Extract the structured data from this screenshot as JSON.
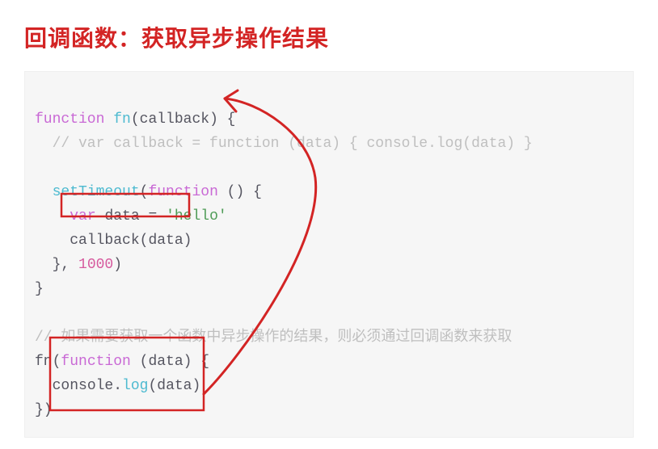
{
  "title": "回调函数：获取异步操作结果",
  "code": {
    "l1_kw": "function",
    "l1_fn": "fn",
    "l1_open": "(",
    "l1_param": "callback",
    "l1_close": ") {",
    "l2_full": "  // var callback = function (data) { console.log(data) }",
    "l3_blank": "",
    "l4_indent": "  ",
    "l4_fn": "setTimeout",
    "l4_open": "(",
    "l4_kw": "function",
    "l4_close": " () {",
    "l5_indent": "    ",
    "l5_kw": "var",
    "l5_sp": " ",
    "l5_id": "data",
    "l5_eq": " = ",
    "l5_str": "'hello'",
    "l6_indent": "    ",
    "l6_call": "callback",
    "l6_open": "(",
    "l6_arg": "data",
    "l6_close": ")",
    "l7_indent": "  }, ",
    "l7_num": "1000",
    "l7_close": ")",
    "l8": "}",
    "l9_blank": "",
    "l10_full": "// 如果需要获取一个函数中异步操作的结果，则必须通过回调函数来获取",
    "l11_fn": "fn",
    "l11_open": "(",
    "l11_kw": "function",
    "l11_rest": " (data) {",
    "l12_indent": "  ",
    "l12_obj": "console",
    "l12_dot": ".",
    "l12_log": "log",
    "l12_open": "(",
    "l12_arg": "data",
    "l12_close": ")",
    "l13": "})"
  },
  "annotations": {
    "box1_desc": "highlight callback(data) call",
    "box2_desc": "highlight callback-function argument to fn",
    "arrow_desc": "arrow from callback body up to callback parameter"
  },
  "colors": {
    "title": "#d32424",
    "keyword": "#c969d5",
    "function": "#4dbad0",
    "string": "#4f9c57",
    "number": "#d65a9e",
    "comment": "#bfbfbf",
    "annotation": "#d32424"
  }
}
